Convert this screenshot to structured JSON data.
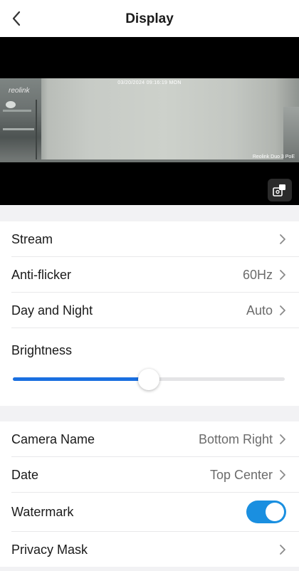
{
  "header": {
    "title": "Display",
    "back_icon": "chevron-left-icon"
  },
  "preview": {
    "timestamp": "03/20/2024 09:16:19 MON",
    "logo_text": "reolink",
    "camera_label": "Reolink Duo 3 PoE",
    "snapshot_icon": "camera-switch-icon"
  },
  "settings": {
    "stream": {
      "label": "Stream",
      "value": ""
    },
    "anti_flicker": {
      "label": "Anti-flicker",
      "value": "60Hz"
    },
    "day_night": {
      "label": "Day and Night",
      "value": "Auto"
    },
    "brightness": {
      "label": "Brightness",
      "level": 0.5
    }
  },
  "osd": {
    "camera_name": {
      "label": "Camera Name",
      "value": "Bottom Right"
    },
    "date": {
      "label": "Date",
      "value": "Top Center"
    },
    "watermark": {
      "label": "Watermark",
      "enabled": true
    },
    "privacy_mask": {
      "label": "Privacy Mask"
    }
  },
  "colors": {
    "accent": "#1a6fe0",
    "toggle_on": "#1a8fe0",
    "background": "#f2f2f4"
  }
}
